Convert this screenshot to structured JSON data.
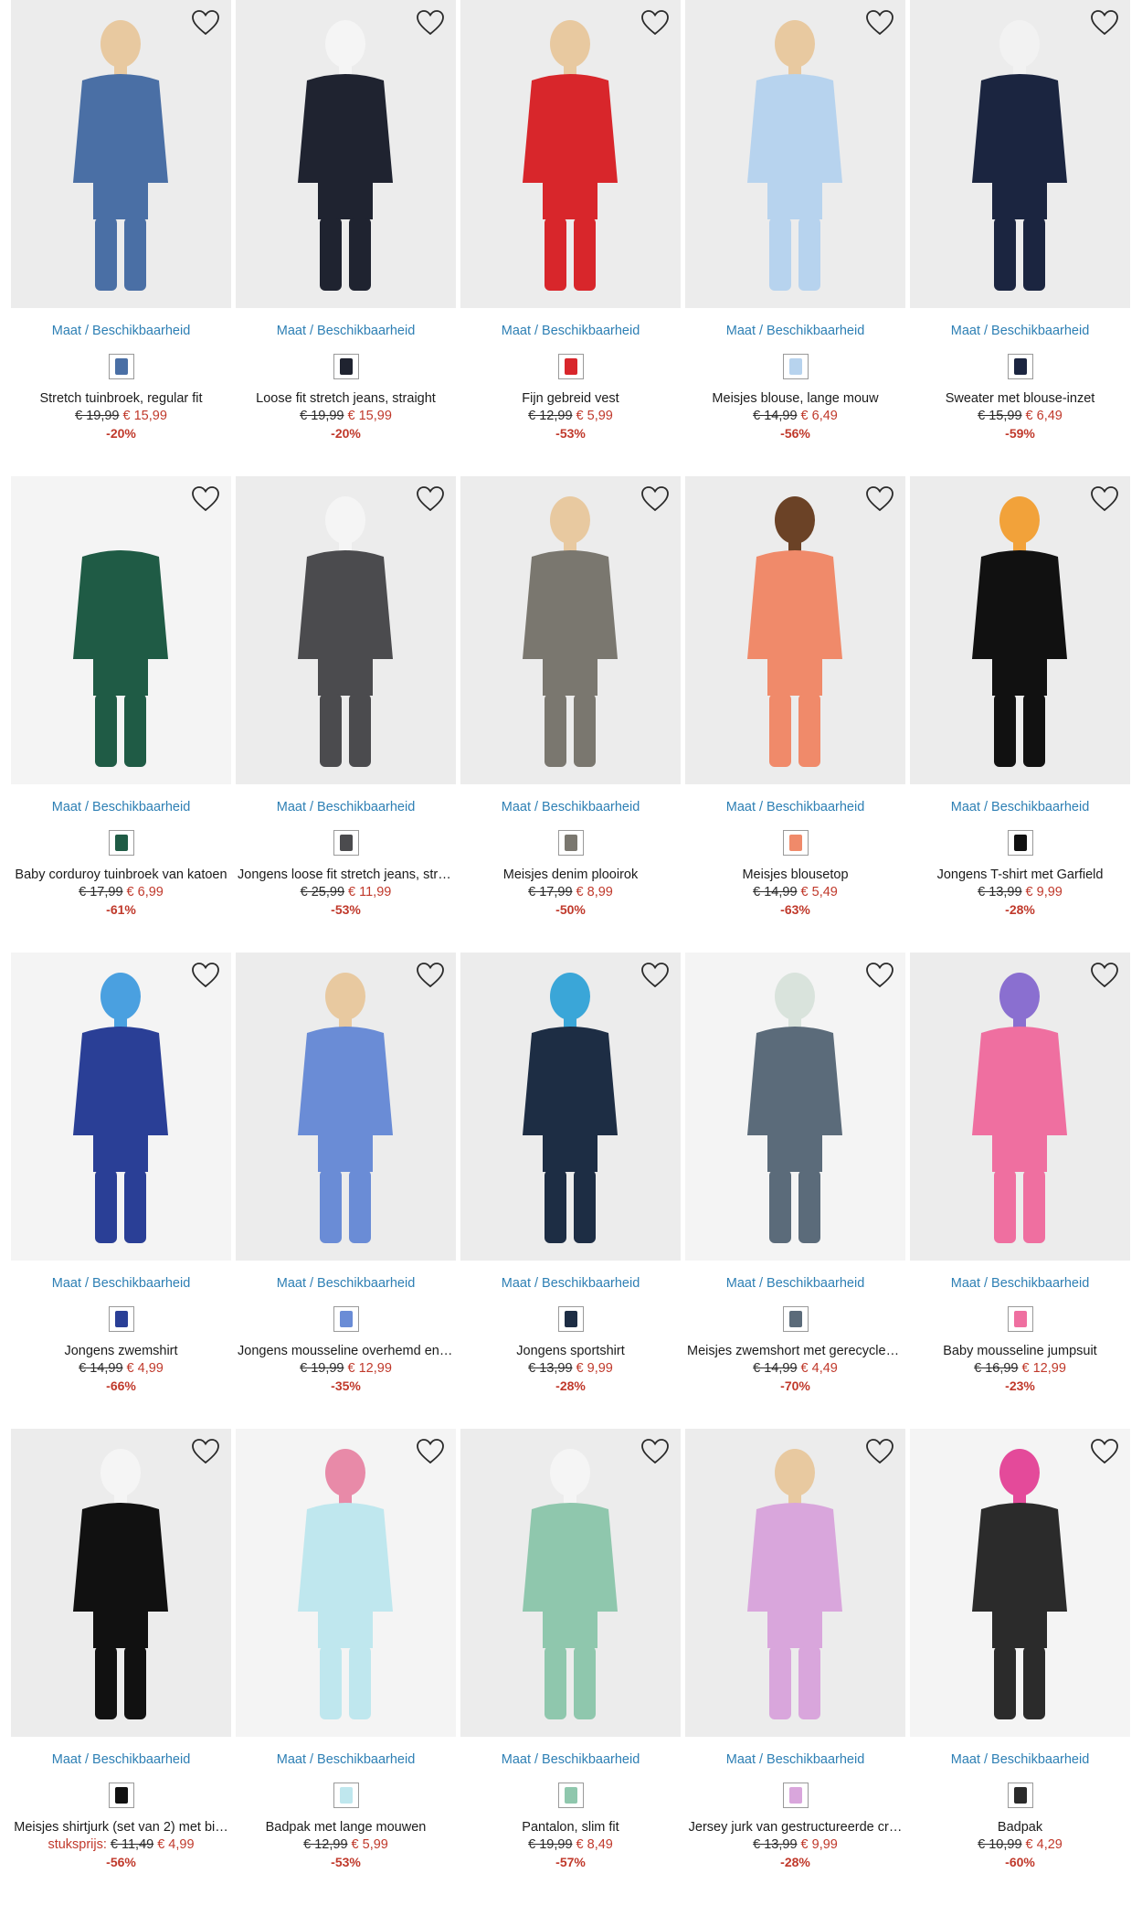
{
  "size_link_label": "Maat / Beschikbaarheid",
  "colors": {
    "price_red": "#c0392b",
    "link_blue": "#2d7fb4"
  },
  "products": [
    {
      "name": "Stretch tuinbroek, regular fit",
      "old": "€ 19,99",
      "new": "€ 15,99",
      "discount": "-20%",
      "bg": "#ececec",
      "main": "#4a6fa5",
      "accent": "#e8c9a0",
      "swatch": "#4a6fa5",
      "icon": "overall-icon"
    },
    {
      "name": "Loose fit stretch jeans, straight",
      "old": "€ 19,99",
      "new": "€ 15,99",
      "discount": "-20%",
      "bg": "#ececec",
      "main": "#1f2330",
      "accent": "#f5f5f5",
      "swatch": "#1f2330",
      "icon": "jeans-icon"
    },
    {
      "name": "Fijn gebreid vest",
      "old": "€ 12,99",
      "new": "€ 5,99",
      "discount": "-53%",
      "bg": "#ececec",
      "main": "#d8262b",
      "accent": "#e8c9a0",
      "swatch": "#d8262b",
      "icon": "cardigan-icon"
    },
    {
      "name": "Meisjes blouse, lange mouw",
      "old": "€ 14,99",
      "new": "€ 6,49",
      "discount": "-56%",
      "bg": "#ececec",
      "main": "#b7d3ee",
      "accent": "#e8c9a0",
      "swatch": "#b7d3ee",
      "icon": "blouse-icon"
    },
    {
      "name": "Sweater met blouse-inzet",
      "old": "€ 15,99",
      "new": "€ 6,49",
      "discount": "-59%",
      "bg": "#ececec",
      "main": "#1b2540",
      "accent": "#f2f2f2",
      "swatch": "#1b2540",
      "icon": "sweater-icon"
    },
    {
      "name": "Baby corduroy tuinbroek van katoen",
      "old": "€ 17,99",
      "new": "€ 6,99",
      "discount": "-61%",
      "bg": "#f4f4f4",
      "main": "#1f5b45",
      "accent": "#f4f4f4",
      "swatch": "#1f5b45",
      "icon": "overall-icon"
    },
    {
      "name": "Jongens loose fit stretch jeans, stra…",
      "old": "€ 25,99",
      "new": "€ 11,99",
      "discount": "-53%",
      "bg": "#ececec",
      "main": "#4b4b4e",
      "accent": "#f5f5f5",
      "swatch": "#4b4b4e",
      "icon": "jeans-icon"
    },
    {
      "name": "Meisjes denim plooirok",
      "old": "€ 17,99",
      "new": "€ 8,99",
      "discount": "-50%",
      "bg": "#ececec",
      "main": "#7a776f",
      "accent": "#e8c9a0",
      "swatch": "#7a776f",
      "icon": "skirt-icon"
    },
    {
      "name": "Meisjes blousetop",
      "old": "€ 14,99",
      "new": "€ 5,49",
      "discount": "-63%",
      "bg": "#ececec",
      "main": "#f08a6a",
      "accent": "#6b4226",
      "swatch": "#f08a6a",
      "icon": "top-icon"
    },
    {
      "name": "Jongens T-shirt met Garfield",
      "old": "€ 13,99",
      "new": "€ 9,99",
      "discount": "-28%",
      "bg": "#ececec",
      "main": "#111111",
      "accent": "#f2a23a",
      "swatch": "#111111",
      "icon": "tshirt-icon"
    },
    {
      "name": "Jongens zwemshirt",
      "old": "€ 14,99",
      "new": "€ 4,99",
      "discount": "-66%",
      "bg": "#f4f4f4",
      "main": "#2a3f96",
      "accent": "#4aa0e0",
      "swatch": "#2a3f96",
      "icon": "swimshirt-icon"
    },
    {
      "name": "Jongens mousseline overhemd en s…",
      "old": "€ 19,99",
      "new": "€ 12,99",
      "discount": "-35%",
      "bg": "#ececec",
      "main": "#6a8cd6",
      "accent": "#e8c9a0",
      "swatch": "#6a8cd6",
      "icon": "shirt-icon"
    },
    {
      "name": "Jongens sportshirt",
      "old": "€ 13,99",
      "new": "€ 9,99",
      "discount": "-28%",
      "bg": "#ececec",
      "main": "#1d2d44",
      "accent": "#3aa6d8",
      "swatch": "#1d2d44",
      "icon": "sportshirt-icon"
    },
    {
      "name": "Meisjes zwemshort met gerecycled…",
      "old": "€ 14,99",
      "new": "€ 4,49",
      "discount": "-70%",
      "bg": "#f4f4f4",
      "main": "#5b6b7a",
      "accent": "#d9e3dc",
      "swatch": "#5b6b7a",
      "icon": "shorts-icon"
    },
    {
      "name": "Baby mousseline jumpsuit",
      "old": "€ 16,99",
      "new": "€ 12,99",
      "discount": "-23%",
      "bg": "#ececec",
      "main": "#ef6fa0",
      "accent": "#8a6fd0",
      "swatch": "#ef6fa0",
      "icon": "jumpsuit-icon"
    },
    {
      "name": "Meisjes shirtjurk (set van 2) met bi…",
      "prefix": "stuksprijs:",
      "old": "€ 11,49",
      "new": "€ 4,99",
      "discount": "-56%",
      "bg": "#ececec",
      "main": "#111111",
      "accent": "#f5f5f5",
      "swatch": "#111111",
      "icon": "dress-icon"
    },
    {
      "name": "Badpak met lange mouwen",
      "old": "€ 12,99",
      "new": "€ 5,99",
      "discount": "-53%",
      "bg": "#f4f4f4",
      "main": "#bfe7ee",
      "accent": "#e88aa8",
      "swatch": "#bfe7ee",
      "icon": "swimsuit-icon"
    },
    {
      "name": "Pantalon, slim fit",
      "old": "€ 19,99",
      "new": "€ 8,49",
      "discount": "-57%",
      "bg": "#ececec",
      "main": "#8fc7ad",
      "accent": "#f5f5f5",
      "swatch": "#8fc7ad",
      "icon": "trousers-icon"
    },
    {
      "name": "Jersey jurk van gestructureerde cr…",
      "old": "€ 13,99",
      "new": "€ 9,99",
      "discount": "-28%",
      "bg": "#ececec",
      "main": "#d9a6dc",
      "accent": "#e8c9a0",
      "swatch": "#d9a6dc",
      "icon": "dress-icon"
    },
    {
      "name": "Badpak",
      "old": "€ 10,99",
      "new": "€ 4,29",
      "discount": "-60%",
      "bg": "#f4f4f4",
      "main": "#2b2b2b",
      "accent": "#e44a9a",
      "swatch": "#2b2b2b",
      "icon": "swimsuit-icon"
    }
  ]
}
